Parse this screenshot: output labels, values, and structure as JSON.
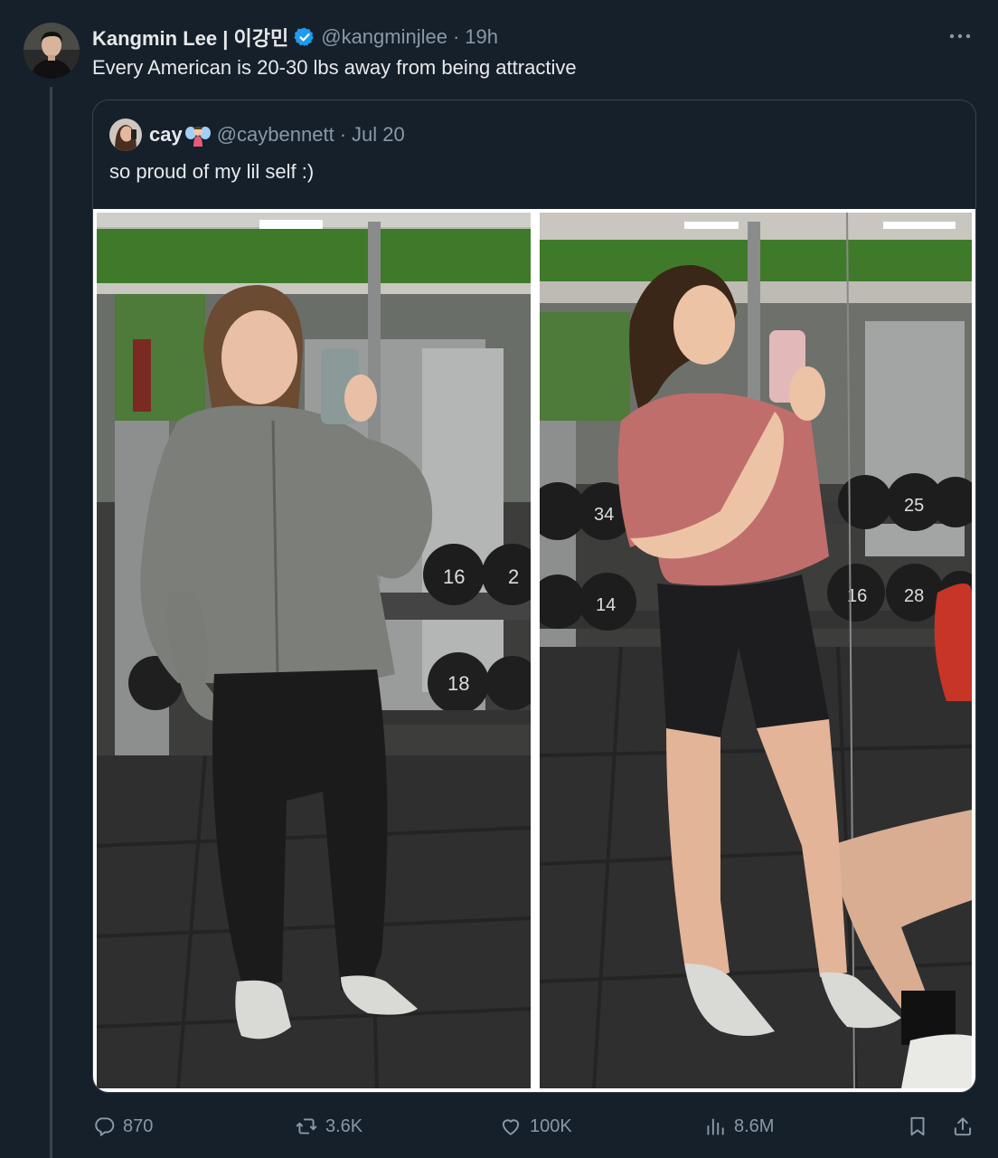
{
  "tweet": {
    "author_name": "Kangmin Lee | 이강민",
    "handle": "@kangminjlee",
    "separator": "·",
    "time": "19h",
    "text": "Every American is 20-30 lbs away from being attractive"
  },
  "quote": {
    "author_name": "cay",
    "handle": "@caybennett",
    "separator": "·",
    "time": "Jul 20",
    "text": "so proud of my lil self :)",
    "photo_left": {
      "dumbbell_labels": [
        "16",
        "2",
        "18"
      ]
    },
    "photo_right": {
      "dumbbell_labels": [
        "34",
        "14",
        "25",
        "28",
        "16"
      ]
    }
  },
  "actions": {
    "replies": "870",
    "reposts": "3.6K",
    "likes": "100K",
    "views": "8.6M"
  },
  "colors": {
    "background": "#15202b",
    "text": "#e7e9ea",
    "secondary": "#8b98a5",
    "border": "#38444d",
    "verified": "#1d9bf0"
  },
  "icons": [
    "more-icon",
    "verified-badge-icon",
    "reply-icon",
    "repost-icon",
    "like-icon",
    "views-icon",
    "bookmark-icon",
    "share-icon"
  ]
}
